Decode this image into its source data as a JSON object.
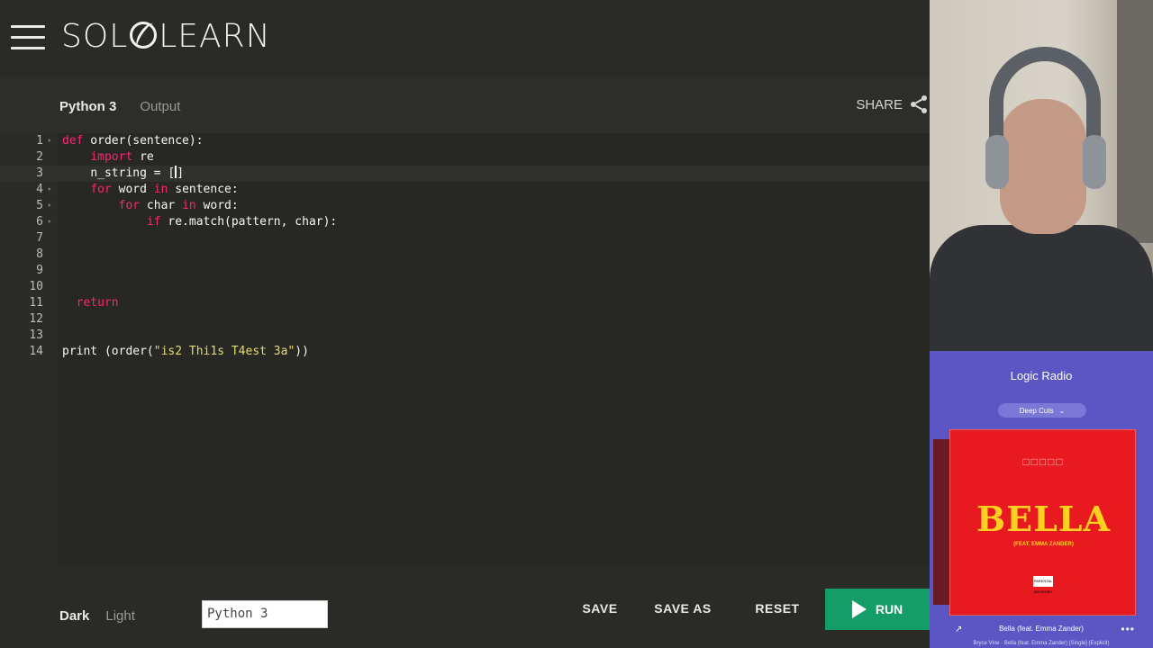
{
  "header": {
    "logo_text_left": "SOL",
    "logo_text_right": "LEARN"
  },
  "editor": {
    "tabs": [
      {
        "label": "Python 3",
        "active": true
      },
      {
        "label": "Output",
        "active": false
      }
    ],
    "share_label": "SHARE",
    "lines": [
      {
        "n": "1",
        "fold": true
      },
      {
        "n": "2",
        "fold": false
      },
      {
        "n": "3",
        "fold": false
      },
      {
        "n": "4",
        "fold": true
      },
      {
        "n": "5",
        "fold": true
      },
      {
        "n": "6",
        "fold": true
      },
      {
        "n": "7",
        "fold": false
      },
      {
        "n": "8",
        "fold": false
      },
      {
        "n": "9",
        "fold": false
      },
      {
        "n": "10",
        "fold": false
      },
      {
        "n": "11",
        "fold": false
      },
      {
        "n": "12",
        "fold": false
      },
      {
        "n": "13",
        "fold": false
      },
      {
        "n": "14",
        "fold": false
      }
    ],
    "code": {
      "l1_kw": "def",
      "l1_rest": " order(sentence):",
      "l2_kw": "import",
      "l2_rest": " re",
      "l3_text": "n_string = [",
      "l3_after": "]",
      "l4_kw1": "for",
      "l4_mid": " word ",
      "l4_kw2": "in",
      "l4_rest": " sentence:",
      "l5_kw1": "for",
      "l5_mid": " char ",
      "l5_kw2": "in",
      "l5_rest": " word:",
      "l6_kw": "if",
      "l6_rest": " re.match(pattern, char):",
      "l11_kw": "return",
      "l14_pre": "print (order(",
      "l14_str": "\"is2 Thi1s T4est 3a\"",
      "l14_post": "))"
    }
  },
  "bottom": {
    "theme_dark": "Dark",
    "theme_light": "Light",
    "language_value": "Python 3",
    "save": "SAVE",
    "save_as": "SAVE AS",
    "reset": "RESET",
    "run": "RUN"
  },
  "music": {
    "station": "Logic Radio",
    "playlist": "Deep Cuts",
    "album_boxes": "□□□□□",
    "album_title": "BELLA",
    "album_feat": "(FEAT. EMMA ZANDER)",
    "advisory": "PARENTAL ADVISORY",
    "track": "Bella (feat. Emma Zander)",
    "subline": "Bryce Vine  ·  Bella (feat. Emma Zander) [Single] (Explicit)"
  },
  "colors": {
    "accent_run": "#149d67",
    "keyword": "#f92672",
    "string": "#e6db74",
    "music_bg": "#5b56c4",
    "album_red": "#e8191f"
  },
  "icons": [
    "hamburger-menu-icon",
    "share-icon",
    "play-icon",
    "chevron-down-icon",
    "more-icon"
  ]
}
